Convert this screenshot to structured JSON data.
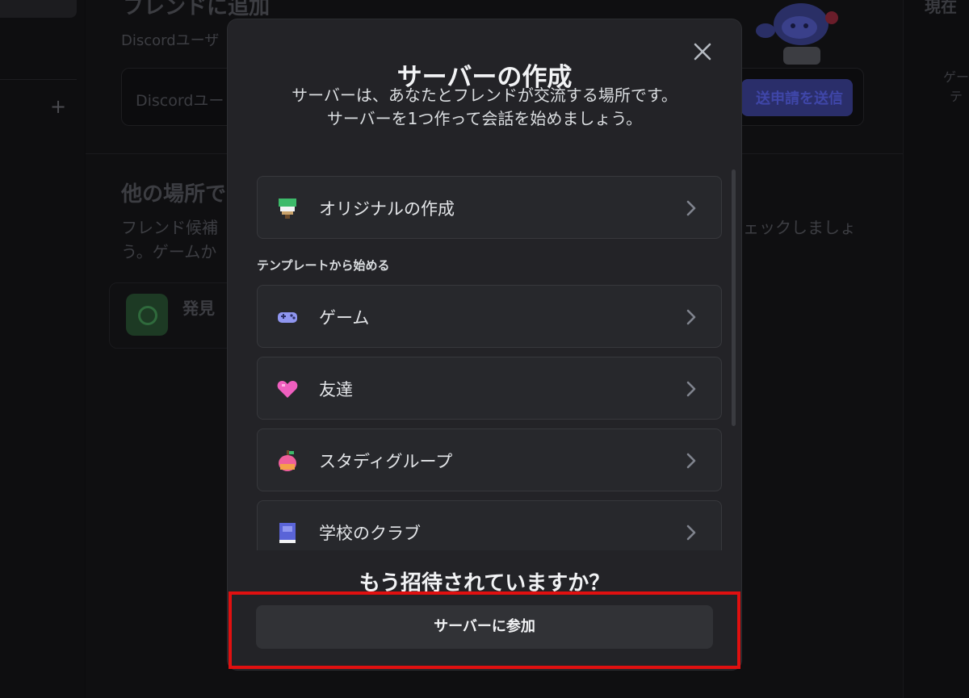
{
  "background": {
    "add_friend_title": "フレンドに追加",
    "add_friend_sub": "Discordユーザ",
    "input_placeholder": "Discordユー",
    "send_button": "送申請を送信",
    "other_places_title": "他の場所で",
    "other_places_text1": "フレンド候補",
    "other_places_text2": "う。ゲームか",
    "other_places_right": "ェックしましょ",
    "explore_label": "発見",
    "right_title": "現在",
    "right_small1": "ゲー",
    "right_small2": "テ"
  },
  "modal": {
    "title": "サーバーの作成",
    "description_line1": "サーバーは、あなたとフレンドが交流する場所です。",
    "description_line2": "サーバーを1つ作って会話を始めましょう。",
    "create_original": {
      "label": "オリジナルの作成",
      "icon": "paintbrush-icon"
    },
    "templates_heading": "テンプレートから始める",
    "templates": [
      {
        "label": "ゲーム",
        "icon": "gamepad-icon"
      },
      {
        "label": "友達",
        "icon": "heart-icon"
      },
      {
        "label": "スタディグループ",
        "icon": "apple-icon"
      },
      {
        "label": "学校のクラブ",
        "icon": "book-icon"
      }
    ],
    "invite_question": "もう招待されていますか？",
    "join_button": "サーバーに参加"
  },
  "colors": {
    "modal_bg": "#232327",
    "option_bg": "#27282c",
    "highlight": "#e01010",
    "join_button_bg": "#313236"
  }
}
